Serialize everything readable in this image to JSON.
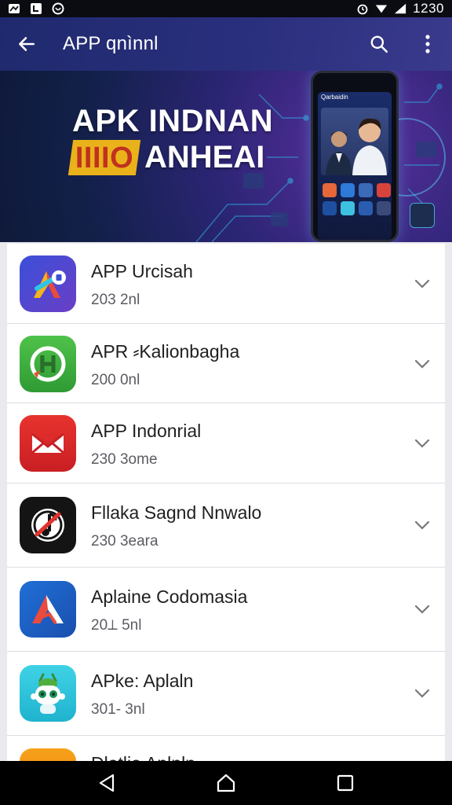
{
  "status_bar": {
    "time": "1230",
    "left_icons": [
      "notification-icon",
      "app-icon",
      "shield-icon"
    ],
    "right_icons": [
      "alarm-icon",
      "wifi-icon",
      "signal-icon"
    ]
  },
  "app_bar": {
    "title": "APP qnìnnl",
    "back_icon": "back-arrow-icon",
    "search_icon": "search-icon",
    "menu_icon": "more-vert-icon"
  },
  "banner": {
    "line1": "APK INDNAN",
    "tag": "IIIIO",
    "line2": "ANHEAI",
    "phone_header": "Qarbaidin"
  },
  "apps": [
    {
      "name": "APP Urcisah",
      "sub": "203 2nl",
      "icon": "app-icon-colorful-a"
    },
    {
      "name": "APR ⸗Kalionbagha",
      "sub": "200 0nl",
      "icon": "app-icon-green-h"
    },
    {
      "name": "APP Indonrial",
      "sub": "230 3ome",
      "icon": "app-icon-red-mail"
    },
    {
      "name": "Fllaka Sagnd Nnwalo",
      "sub": "230 3eara",
      "icon": "app-icon-black-no-music"
    },
    {
      "name": "Aplaine Codomasia",
      "sub": "20⟂ 5nl",
      "icon": "app-icon-blue-a"
    },
    {
      "name": "APke: Aplaln",
      "sub": "301- 3nl",
      "icon": "app-icon-android-robot"
    },
    {
      "name": "Dlatlia Aplnln",
      "sub": "",
      "icon": "app-icon-orange"
    }
  ],
  "nav": {
    "back": "nav-back-icon",
    "home": "nav-home-icon",
    "recents": "nav-recents-icon"
  },
  "colors": {
    "app_bar": "#2a2f7d",
    "status_bar": "#0b0b12",
    "list_bg": "#ffffff",
    "page_bg": "#e9e9ee"
  }
}
